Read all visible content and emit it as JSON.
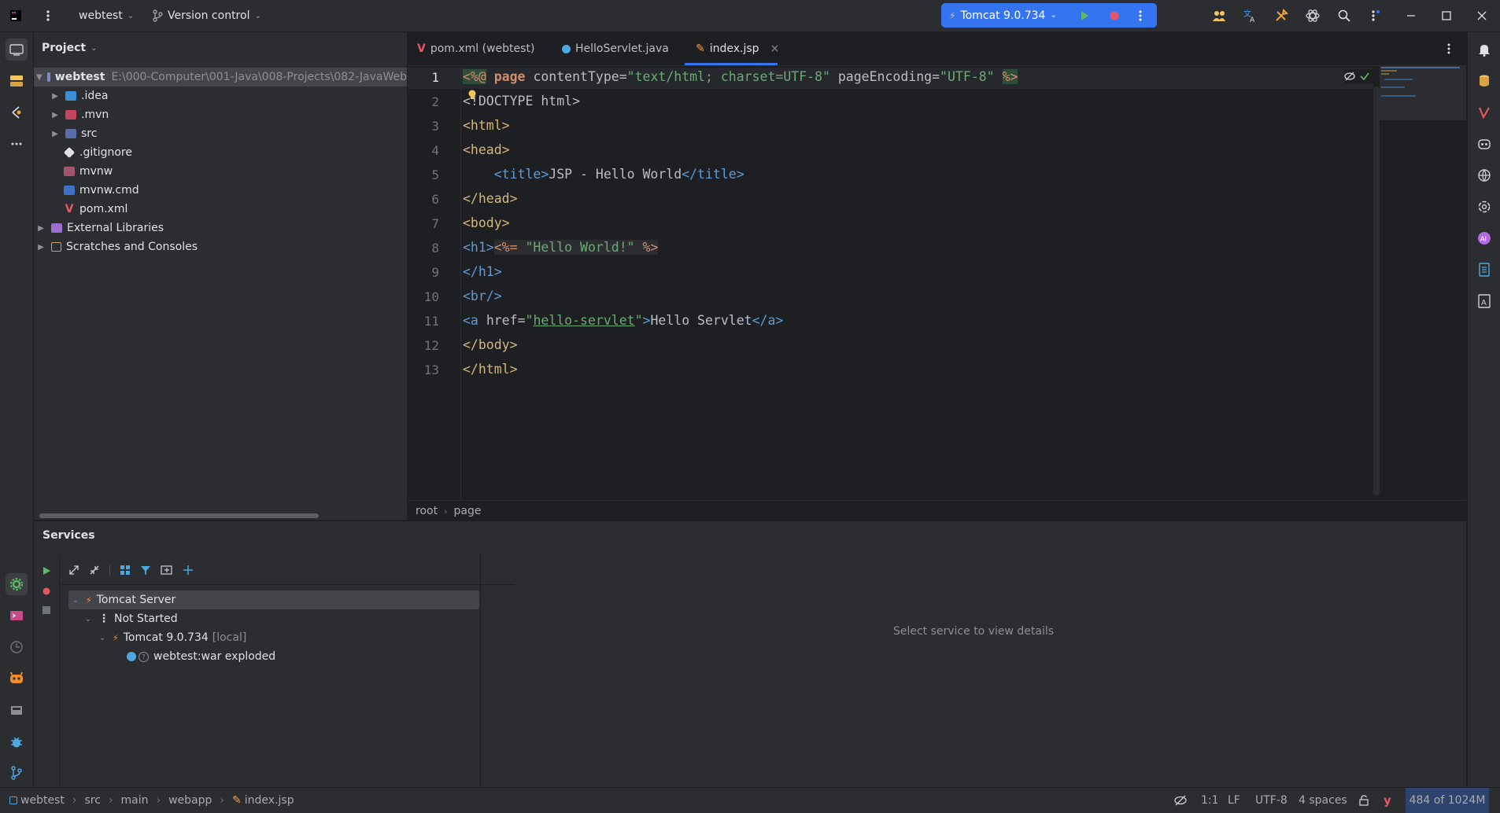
{
  "titlebar": {
    "project_name": "webtest",
    "vcs_label": "Version control",
    "run_config": "Tomcat 9.0.734"
  },
  "project_panel": {
    "title": "Project",
    "root": {
      "name": "webtest",
      "path": "E:\\000-Computer\\001-Java\\008-Projects\\082-JavaWeb"
    },
    "items": [
      {
        "label": ".idea"
      },
      {
        "label": ".mvn"
      },
      {
        "label": "src"
      },
      {
        "label": ".gitignore"
      },
      {
        "label": "mvnw"
      },
      {
        "label": "mvnw.cmd"
      },
      {
        "label": "pom.xml"
      }
    ],
    "external_libraries": "External Libraries",
    "scratches": "Scratches and Consoles"
  },
  "tabs": [
    {
      "label": "pom.xml (webtest)"
    },
    {
      "label": "HelloServlet.java"
    },
    {
      "label": "index.jsp",
      "close": "×"
    }
  ],
  "editor": {
    "line_numbers": [
      "1",
      "2",
      "3",
      "4",
      "5",
      "6",
      "7",
      "8",
      "9",
      "10",
      "11",
      "12",
      "13"
    ],
    "breadcrumb": [
      "root",
      "page"
    ],
    "lines": {
      "l1": {
        "open": "<%@",
        "kw": "page",
        "a1": "contentType",
        "eq": "=",
        "v1": "\"text/html; charset=UTF-8\"",
        "a2": "pageEncoding",
        "v2": "\"UTF-8\"",
        "close": "%>"
      },
      "l2": {
        "text": "<!DOCTYPE html>"
      },
      "l3": {
        "text": "<html>"
      },
      "l4": {
        "text": "<head>"
      },
      "l5": {
        "open": "<title>",
        "text": "JSP - Hello World",
        "close": "</title>"
      },
      "l6": {
        "text": "</head>"
      },
      "l7": {
        "text": "<body>"
      },
      "l8": {
        "open": "<h1>",
        "expr_open": "<%=",
        "str": "\"Hello World!\"",
        "expr_close": "%>"
      },
      "l9": {
        "text": "</h1>"
      },
      "l10": {
        "text": "<br/>"
      },
      "l11": {
        "open": "<a",
        "attr": "href",
        "eq": "=",
        "q1": "\"",
        "href": "hello-servlet",
        "q2": "\"",
        "gt": ">",
        "text": "Hello Servlet",
        "close": "</a>"
      },
      "l12": {
        "text": "</body>"
      },
      "l13": {
        "text": "</html>"
      }
    }
  },
  "services": {
    "title": "Services",
    "tree": [
      {
        "label": "Tomcat Server"
      },
      {
        "label": "Not Started"
      },
      {
        "label": "Tomcat 9.0.734",
        "suffix": "[local]"
      },
      {
        "label": "webtest:war exploded"
      }
    ],
    "details_placeholder": "Select service to view details"
  },
  "statusbar": {
    "crumbs": [
      "webtest",
      "src",
      "main",
      "webapp",
      "index.jsp"
    ],
    "position": "1:1",
    "line_sep": "LF",
    "encoding": "UTF-8",
    "indent": "4 spaces",
    "memory": "484 of 1024M"
  },
  "colors": {
    "accent": "#3574f0",
    "run_green": "#5fb865",
    "stop_red": "#e55765"
  }
}
